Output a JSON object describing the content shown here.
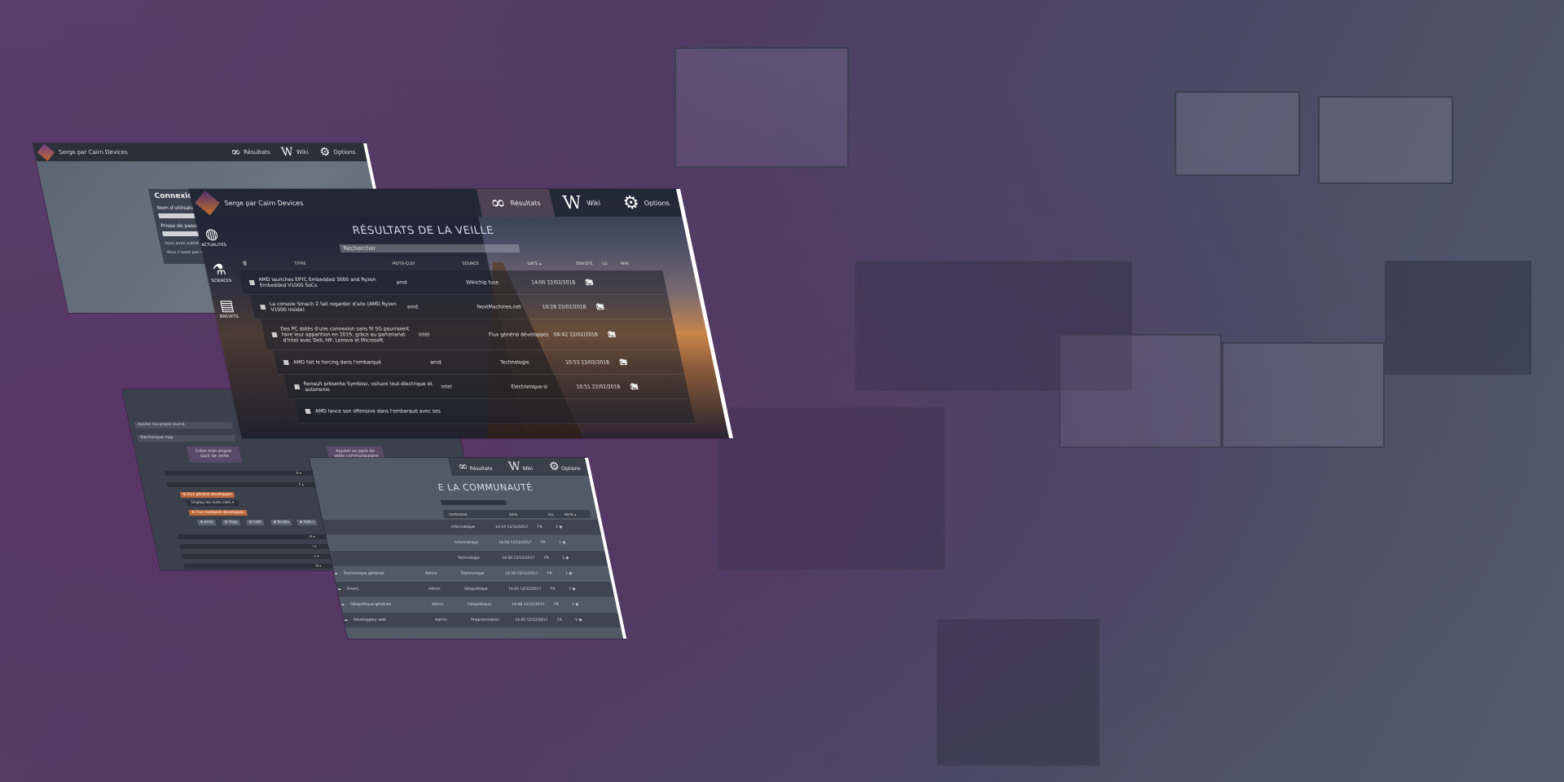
{
  "brand": {
    "login_title": "Serge par Cairn Devices",
    "main_title": "Serge par Cairn Devices"
  },
  "nav": {
    "results": "Résultats",
    "wiki": "Wiki",
    "options": "Options",
    "wiki_glyph": "W",
    "results_icon": "binoculars-icon",
    "options_icon": "gear-icon"
  },
  "login": {
    "heading": "Connexion",
    "username_label": "Nom d'utilisateur",
    "password_label": "Prisse de passe",
    "note_line1": "Vous avez oublié votre ph",
    "note_line2": "Vous n'avez pas de compt"
  },
  "sidebar": {
    "items": [
      {
        "label": "ACTUALITÉS",
        "icon": "globe-icon",
        "glyph": "◍"
      },
      {
        "label": "SCIENCES",
        "icon": "flask-icon",
        "glyph": "⚗"
      },
      {
        "label": "BREVETS",
        "icon": "document-icon",
        "glyph": "▤"
      }
    ]
  },
  "results": {
    "title": "RÉSULTATS DE LA VEILLE",
    "search_placeholder": "Rechercher",
    "columns": {
      "title": "TITRE",
      "keyword": "MOTS-CLEF",
      "source": "SOURCE",
      "date": "DATE ▴",
      "sent": "ENVOYÉ",
      "read": "LU",
      "wiki": "WIKI"
    },
    "rows": [
      {
        "title": "AMD launches EPYC Embedded 3000 and Ryzen Embedded V1000 SoCs",
        "keyword": "amd",
        "source": "Wikichip fuse",
        "date": "14:00 22/02/2018"
      },
      {
        "title": "La console Smach Z fait regarder d'aile (AMD Ryzen V1000 inside)",
        "keyword": "amd",
        "source": "NextMachines.net",
        "date": "10:28 22/02/2018"
      },
      {
        "title": "Des PC dotés d'une connexion sans fil 5G pourraient faire leur apparition en 2019, grâce au partenariat d'Intel avec Dell, HP, Lenovo et Microsoft",
        "keyword": "intel",
        "source": "Flux général développez",
        "date": "04:42 22/02/2018"
      },
      {
        "title": "AMD fait le forcing dans l'embarqué",
        "keyword": "amd",
        "source": "Technologie",
        "date": "10:53 22/02/2018"
      },
      {
        "title": "Renault présente Symbioz, voiture tout-électrique et autonome",
        "keyword": "intel",
        "source": "Electronique-si",
        "date": "10:51 22/02/2018"
      },
      {
        "title": "AMD lance son offensive dans l'embarqué avec ses",
        "keyword": "",
        "source": "",
        "date": ""
      }
    ]
  },
  "community": {
    "title": "E LA COMMUNAUTÉ",
    "results": "Résultats",
    "wiki": "Wiki",
    "options": "Options",
    "columns": {
      "category": "CATÉGORIE",
      "date": "DATE",
      "all": "ALL",
      "note": "NOTE ▴"
    },
    "rows": [
      {
        "name": "",
        "owner": "",
        "category": "Informatique",
        "date": "14:14 12/12/2017",
        "lang": "FR",
        "note": "1 ◉"
      },
      {
        "name": "",
        "owner": "",
        "category": "Informatique",
        "date": "14:28 12/12/2017",
        "lang": "FR",
        "note": "1 ◉"
      },
      {
        "name": "",
        "owner": "",
        "category": "Technologie",
        "date": "14:00 12/12/2017",
        "lang": "FR",
        "note": "1 ◉"
      },
      {
        "name": "Électronique générale",
        "owner": "Admin",
        "category": "Électronique",
        "date": "14:39 12/12/2017",
        "lang": "FR",
        "note": "1 ◉"
      },
      {
        "name": "Divers",
        "owner": "Admin",
        "category": "Géopolitique",
        "date": "14:41 12/12/2017",
        "lang": "FR",
        "note": "1 ◉"
      },
      {
        "name": "Géopolitique générale",
        "owner": "Admin",
        "category": "Géopolitique",
        "date": "14:48 12/12/2017",
        "lang": "FR",
        "note": "1 ◉"
      },
      {
        "name": "Développeur web",
        "owner": "Admin",
        "category": "Programmation",
        "date": "14:40 12/12/2017",
        "lang": "FR",
        "note": "1 ◉"
      }
    ]
  },
  "sources": {
    "add_source": "Ajouter ma propre source",
    "electronic": "Électronique mag",
    "create_pack": "Créer mon propre pack de veille",
    "add_pack": "Ajouter un pack de veille communautaire",
    "bar_e": "E ▾",
    "bar_f": "F ▴",
    "bar_m": "M ▾",
    "bar_i": "I ▾",
    "bar_l": "L ▾",
    "bar_m2": "M ▾",
    "tag_dev": "⊗ Flux général developpez",
    "show_keywords": "Display les mots-clefs ▾",
    "tag_hardware": "⊗ Flux hardware developpez",
    "chips": [
      "⊗ Amd",
      "⊗ Yoga",
      "⊗ Intel",
      "⊗ Nvidia",
      "⊗ Odb c"
    ]
  },
  "colors": {
    "accent_orange": "#c0673a",
    "accent_purple": "#5a4a6a",
    "topbar": "#2a2f38"
  }
}
